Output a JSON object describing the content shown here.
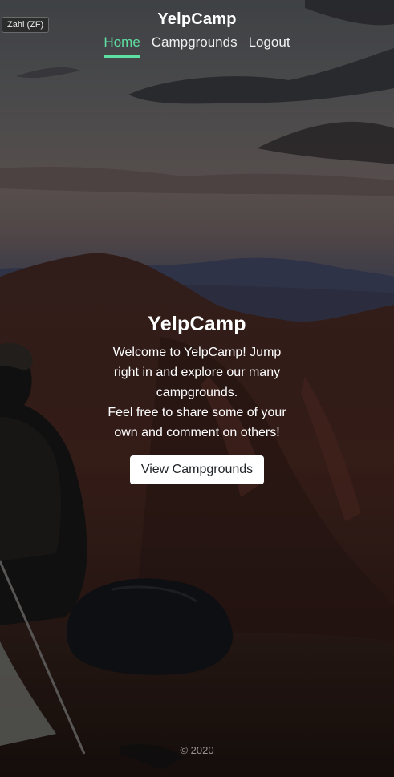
{
  "user_badge": "Zahi (ZF)",
  "header": {
    "brand": "YelpCamp",
    "nav": [
      {
        "label": "Home",
        "active": true
      },
      {
        "label": "Campgrounds",
        "active": false
      },
      {
        "label": "Logout",
        "active": false
      }
    ]
  },
  "hero": {
    "title": "YelpCamp",
    "paragraph1": "Welcome to YelpCamp! Jump right in and explore our many campgrounds.",
    "paragraph2": "Feel free to share some of your own and comment on others!",
    "button_label": "View Campgrounds"
  },
  "footer": {
    "copyright": "© 2020"
  },
  "colors": {
    "accent": "#5fe0a3",
    "button_bg": "#ffffff",
    "button_text": "#212529"
  }
}
